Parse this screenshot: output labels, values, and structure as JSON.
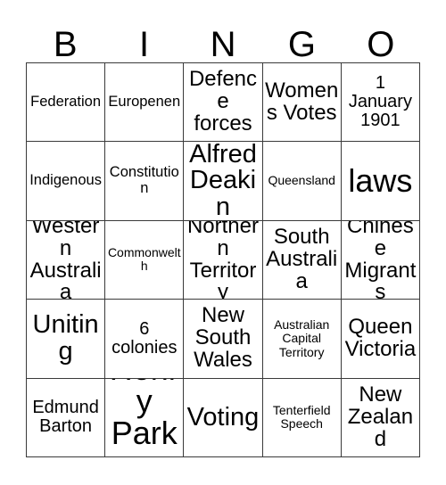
{
  "card": {
    "title": "BINGO",
    "header_letters": [
      "B",
      "I",
      "N",
      "G",
      "O"
    ],
    "columns": 5,
    "rows": 5,
    "border_color": "#3a3a3a",
    "text_color": "#000000",
    "background_color": "#ffffff",
    "cells": [
      {
        "text": "Federation",
        "size": "s"
      },
      {
        "text": "Europenen",
        "size": "s"
      },
      {
        "text": "Defence forces",
        "size": "l"
      },
      {
        "text": "Womens Votes",
        "size": "l"
      },
      {
        "text": "1 January 1901",
        "size": "m"
      },
      {
        "text": "Indigenous",
        "size": "s"
      },
      {
        "text": "Constitution",
        "size": "s"
      },
      {
        "text": "Alfred Deakin",
        "size": "xl"
      },
      {
        "text": "Queensland",
        "size": "xs"
      },
      {
        "text": "laws",
        "size": "xxl"
      },
      {
        "text": "Western Australia",
        "size": "l"
      },
      {
        "text": "Commonwelth",
        "size": "xs"
      },
      {
        "text": "Northern Territory",
        "size": "l"
      },
      {
        "text": "South Australia",
        "size": "l"
      },
      {
        "text": "Chinese Migrants",
        "size": "l"
      },
      {
        "text": "Uniting",
        "size": "xl"
      },
      {
        "text": "6 colonies",
        "size": "m"
      },
      {
        "text": "New South Wales",
        "size": "l"
      },
      {
        "text": "Australian Capital Territory",
        "size": "xs"
      },
      {
        "text": "Queen Victoria",
        "size": "l"
      },
      {
        "text": "Edmund Barton",
        "size": "m"
      },
      {
        "text": "Henry Parks",
        "size": "xxl"
      },
      {
        "text": "Voting",
        "size": "xl"
      },
      {
        "text": "Tenterfield Speech",
        "size": "xs"
      },
      {
        "text": "New Zealand",
        "size": "l"
      }
    ]
  }
}
